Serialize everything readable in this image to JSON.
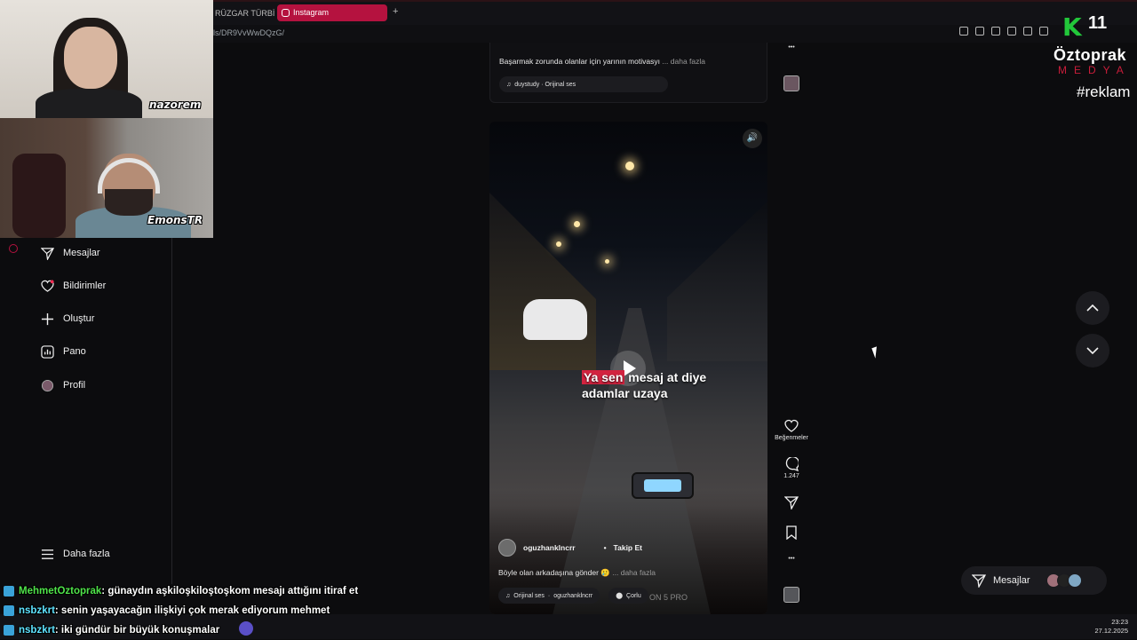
{
  "browser": {
    "tab_inactive": "RÜZGAR TÜRBİN",
    "tab_active": "Instagram",
    "url": "ls/DR9VvWwDQzG/"
  },
  "webcams": {
    "cam1_label": "nazorem",
    "cam2_label": "EmonsTR"
  },
  "sidebar": {
    "items": [
      {
        "label": "Mesajlar",
        "icon": "send-icon"
      },
      {
        "label": "Bildirimler",
        "icon": "heart-icon"
      },
      {
        "label": "Oluştur",
        "icon": "plus-icon"
      },
      {
        "label": "Pano",
        "icon": "chart-icon"
      },
      {
        "label": "Profil",
        "icon": "avatar"
      }
    ],
    "more_label": "Daha fazla"
  },
  "prev_post": {
    "caption": "Başarmak zorunda olanlar için yarının motivasyı",
    "more": "... daha fazla",
    "audio": "duystudy · Orijinal ses"
  },
  "reel": {
    "overlay_line1_highlight": "Ya sen",
    "overlay_line1_rest": " mesaj at diye",
    "overlay_line2": "adamlar uzaya",
    "username": "oguzhanklncrr",
    "follow_label": "Takip Et",
    "caption": "Böyle olan arkadaşına gönder 🥲",
    "more": "... daha fazla",
    "audio": "Orijinal ses",
    "audio_user": "oguzhanklncrr",
    "location": "Çorlu",
    "watermark": "ON 5 PRO"
  },
  "actions": {
    "like_label": "Beğenmeler",
    "comment_count": "1.247"
  },
  "messages_pill": {
    "label": "Mesajlar"
  },
  "branding": {
    "channel_letter": "K",
    "channel_number": "11",
    "name": "Öztoprak",
    "sub": "MEDYA",
    "tag": "#reklam"
  },
  "chat": [
    {
      "user": "MehmetOztoprak",
      "message": ": günaydın aşkiloşkiloştoşkom mesajı attığını itiraf et",
      "color": "#4fe34a"
    },
    {
      "user": "nsbzkrt",
      "message": ": senin yaşayacağın ilişkiyi çok merak ediyorum mehmet",
      "color": "#5ee3ff"
    },
    {
      "user": "nsbzkrt",
      "message": ": iki gündür bir büyük konuşmalar",
      "color": "#5ee3ff"
    }
  ],
  "clock": {
    "time": "23:23",
    "date": "27.12.2025"
  },
  "colors": {
    "accent": "#b5123f",
    "brand_green": "#22c73a"
  }
}
